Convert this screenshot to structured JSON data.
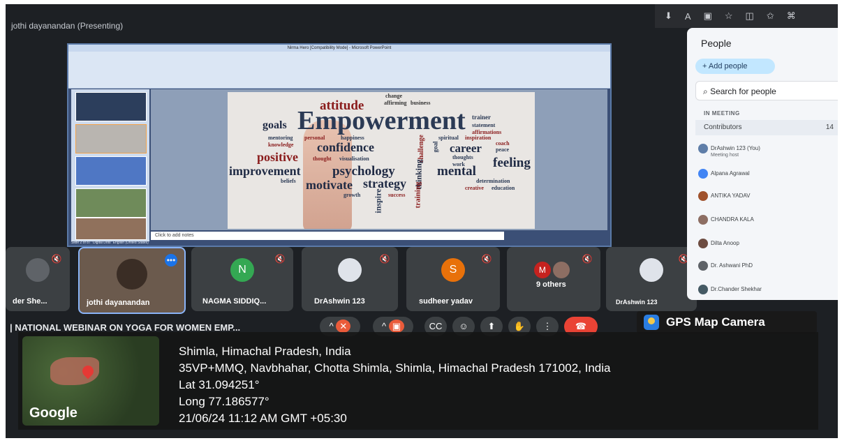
{
  "presenter_label": "jothi dayanandan (Presenting)",
  "ppt": {
    "window_title": "Nirma Hero [Compatibility Mode] - Microsoft PowerPoint",
    "notes_placeholder": "Click to add notes",
    "status": "Slide 2 of 87   \"Digital Dots\"   English (United States)"
  },
  "word_cloud": {
    "empowerment": "Empowerment",
    "attitude": "attitude",
    "goals": "goals",
    "confidence": "confidence",
    "positive": "positive",
    "improvement": "improvement",
    "psychology": "psychology",
    "motivate": "motivate",
    "strategy": "strategy",
    "career": "career",
    "mental": "mental",
    "feeling": "feeling",
    "change": "change",
    "trainer": "trainer",
    "happiness": "happiness",
    "success": "success",
    "growth": "growth",
    "inspire": "inspire",
    "training": "training",
    "thinking": "thinking",
    "challenge": "challenge",
    "spiritual": "spiritual",
    "inspiration": "inspiration",
    "determination": "determination",
    "creative": "creative",
    "education": "education",
    "beliefs": "beliefs",
    "knowledge": "knowledge",
    "thought": "thought",
    "visualisation": "visualisation",
    "statement": "statement",
    "affirmations": "affirmations",
    "coach": "coach",
    "peace": "peace",
    "work": "work",
    "thoughts": "thoughts",
    "mentoring": "mentoring",
    "personal": "personal",
    "affirming": "affirming",
    "business": "business",
    "goal": "goal"
  },
  "tiles": [
    {
      "name": "der She...",
      "initial": "",
      "color": "#5f6368"
    },
    {
      "name": "jothi dayanandan",
      "initial": "",
      "color": "#8a6b54"
    },
    {
      "name": "NAGMA SIDDIQ...",
      "initial": "N",
      "color": "#34a853"
    },
    {
      "name": "DrAshwin 123",
      "initial": "",
      "color": "#5f7ea8"
    },
    {
      "name": "sudheer yadav",
      "initial": "S",
      "color": "#e8710a"
    },
    {
      "name": "9 others",
      "initial": "M",
      "color": "#c5221f"
    },
    {
      "name": "DrAshwin 123",
      "initial": "",
      "color": "#5f7ea8"
    }
  ],
  "meeting_title": "| NATIONAL WEBINAR ON YOGA FOR WOMEN EMP...",
  "controls": [
    "mic-off",
    "camera-off",
    "captions",
    "emoji",
    "present",
    "raise-hand",
    "more",
    "leave"
  ],
  "people": {
    "title": "People",
    "add_label": "Add people",
    "search_placeholder": "Search for people",
    "in_meeting": "IN MEETING",
    "contributors": "Contributors",
    "count": "14",
    "list": [
      {
        "name": "DrAshwin 123 (You)",
        "sub": "Meeting host",
        "color": "#5f7ea8"
      },
      {
        "name": "Alpana Agrawal",
        "sub": "",
        "color": "#4285f4"
      },
      {
        "name": "ANTIKA YADAV",
        "sub": "",
        "color": "#a0522d"
      },
      {
        "name": "CHANDRA KALA",
        "sub": "",
        "color": "#8d6e63"
      },
      {
        "name": "Dilta Anoop",
        "sub": "",
        "color": "#6d4c41"
      },
      {
        "name": "Dr. Ashwani PhD",
        "sub": "",
        "color": "#5f6368"
      },
      {
        "name": "Dr.Chander Shekhar",
        "sub": "",
        "color": "#455a64"
      }
    ]
  },
  "gps": {
    "badge": "GPS Map Camera",
    "location": "Shimla, Himachal Pradesh, India",
    "address": "35VP+MMQ, Navbhahar, Chotta Shimla, Shimla, Himachal Pradesh 171002, India",
    "lat": "Lat 31.094251°",
    "long": "Long 77.186577°",
    "datetime": "21/06/24 11:12 AM GMT +05:30",
    "map_brand": "Google"
  }
}
